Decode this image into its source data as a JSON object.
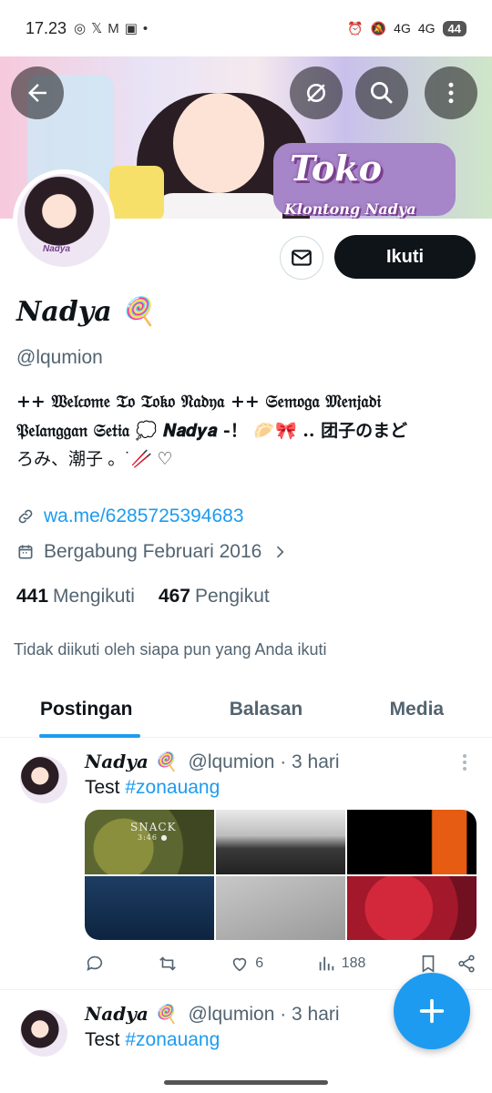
{
  "status_bar": {
    "time": "17.23",
    "left_icons": [
      "whatsapp-icon",
      "x-icon",
      "gmail-icon",
      "brimo-icon",
      "dot-icon"
    ],
    "signal_1": "4G",
    "signal_2": "4G",
    "battery": "44"
  },
  "banner": {
    "title": "Toko",
    "subtitle": "Klontong Nadya"
  },
  "header_buttons": [
    "back-icon",
    "mute-icon",
    "search-icon",
    "more-icon"
  ],
  "profile": {
    "avatar_tag": "Nadya",
    "name": "Nadya 🍭",
    "handle": "@lqumion",
    "bio_line1": "++ 𝔚𝔢𝔩𝔠𝔬𝔪𝔢 𝔗𝔬 𝔗𝔬𝔨𝔬 𝔑𝔞𝔡𝔶𝔞 ++ 𝔖𝔢𝔪𝔬𝔤𝔞 𝔐𝔢𝔫𝔧𝔞𝔡𝔦",
    "bio_line2": "𝔓𝔢𝔩𝔞𝔫𝔤𝔤𝔞𝔫 𝔖𝔢𝔱𝔦𝔞 💭 𝑵𝒂𝒅𝒚𝒂 -！ 🥟🎀 .. 团子のまど",
    "bio_line3": "ろみ、潮子 。˙🥢 ♡",
    "link": "wa.me/6285725394683",
    "joined": "Bergabung Februari 2016",
    "following_count": "441",
    "following_label": "Mengikuti",
    "followers_count": "467",
    "followers_label": "Pengikut",
    "not_followed": "Tidak diikuti oleh siapa pun yang Anda ikuti",
    "follow_button": "Ikuti"
  },
  "tabs": [
    {
      "label": "Postingan",
      "active": true
    },
    {
      "label": "Balasan",
      "active": false
    },
    {
      "label": "Media",
      "active": false
    }
  ],
  "posts": [
    {
      "name": "Nadya 🍭",
      "handle": "@lqumion",
      "time": "· 3 hari",
      "text": "Test",
      "hashtag": "#zonauang",
      "media_overlay_title": "SNACK",
      "media_overlay_time": "3:46 ●",
      "likes": "6",
      "views": "188"
    },
    {
      "name": "Nadya 🍭",
      "handle": "@lqumion",
      "time": "· 3 hari",
      "text": "Test",
      "hashtag": "#zonauang"
    }
  ],
  "colors": {
    "accent": "#1d9bf0",
    "text": "#0f1419",
    "secondary": "#536471"
  }
}
